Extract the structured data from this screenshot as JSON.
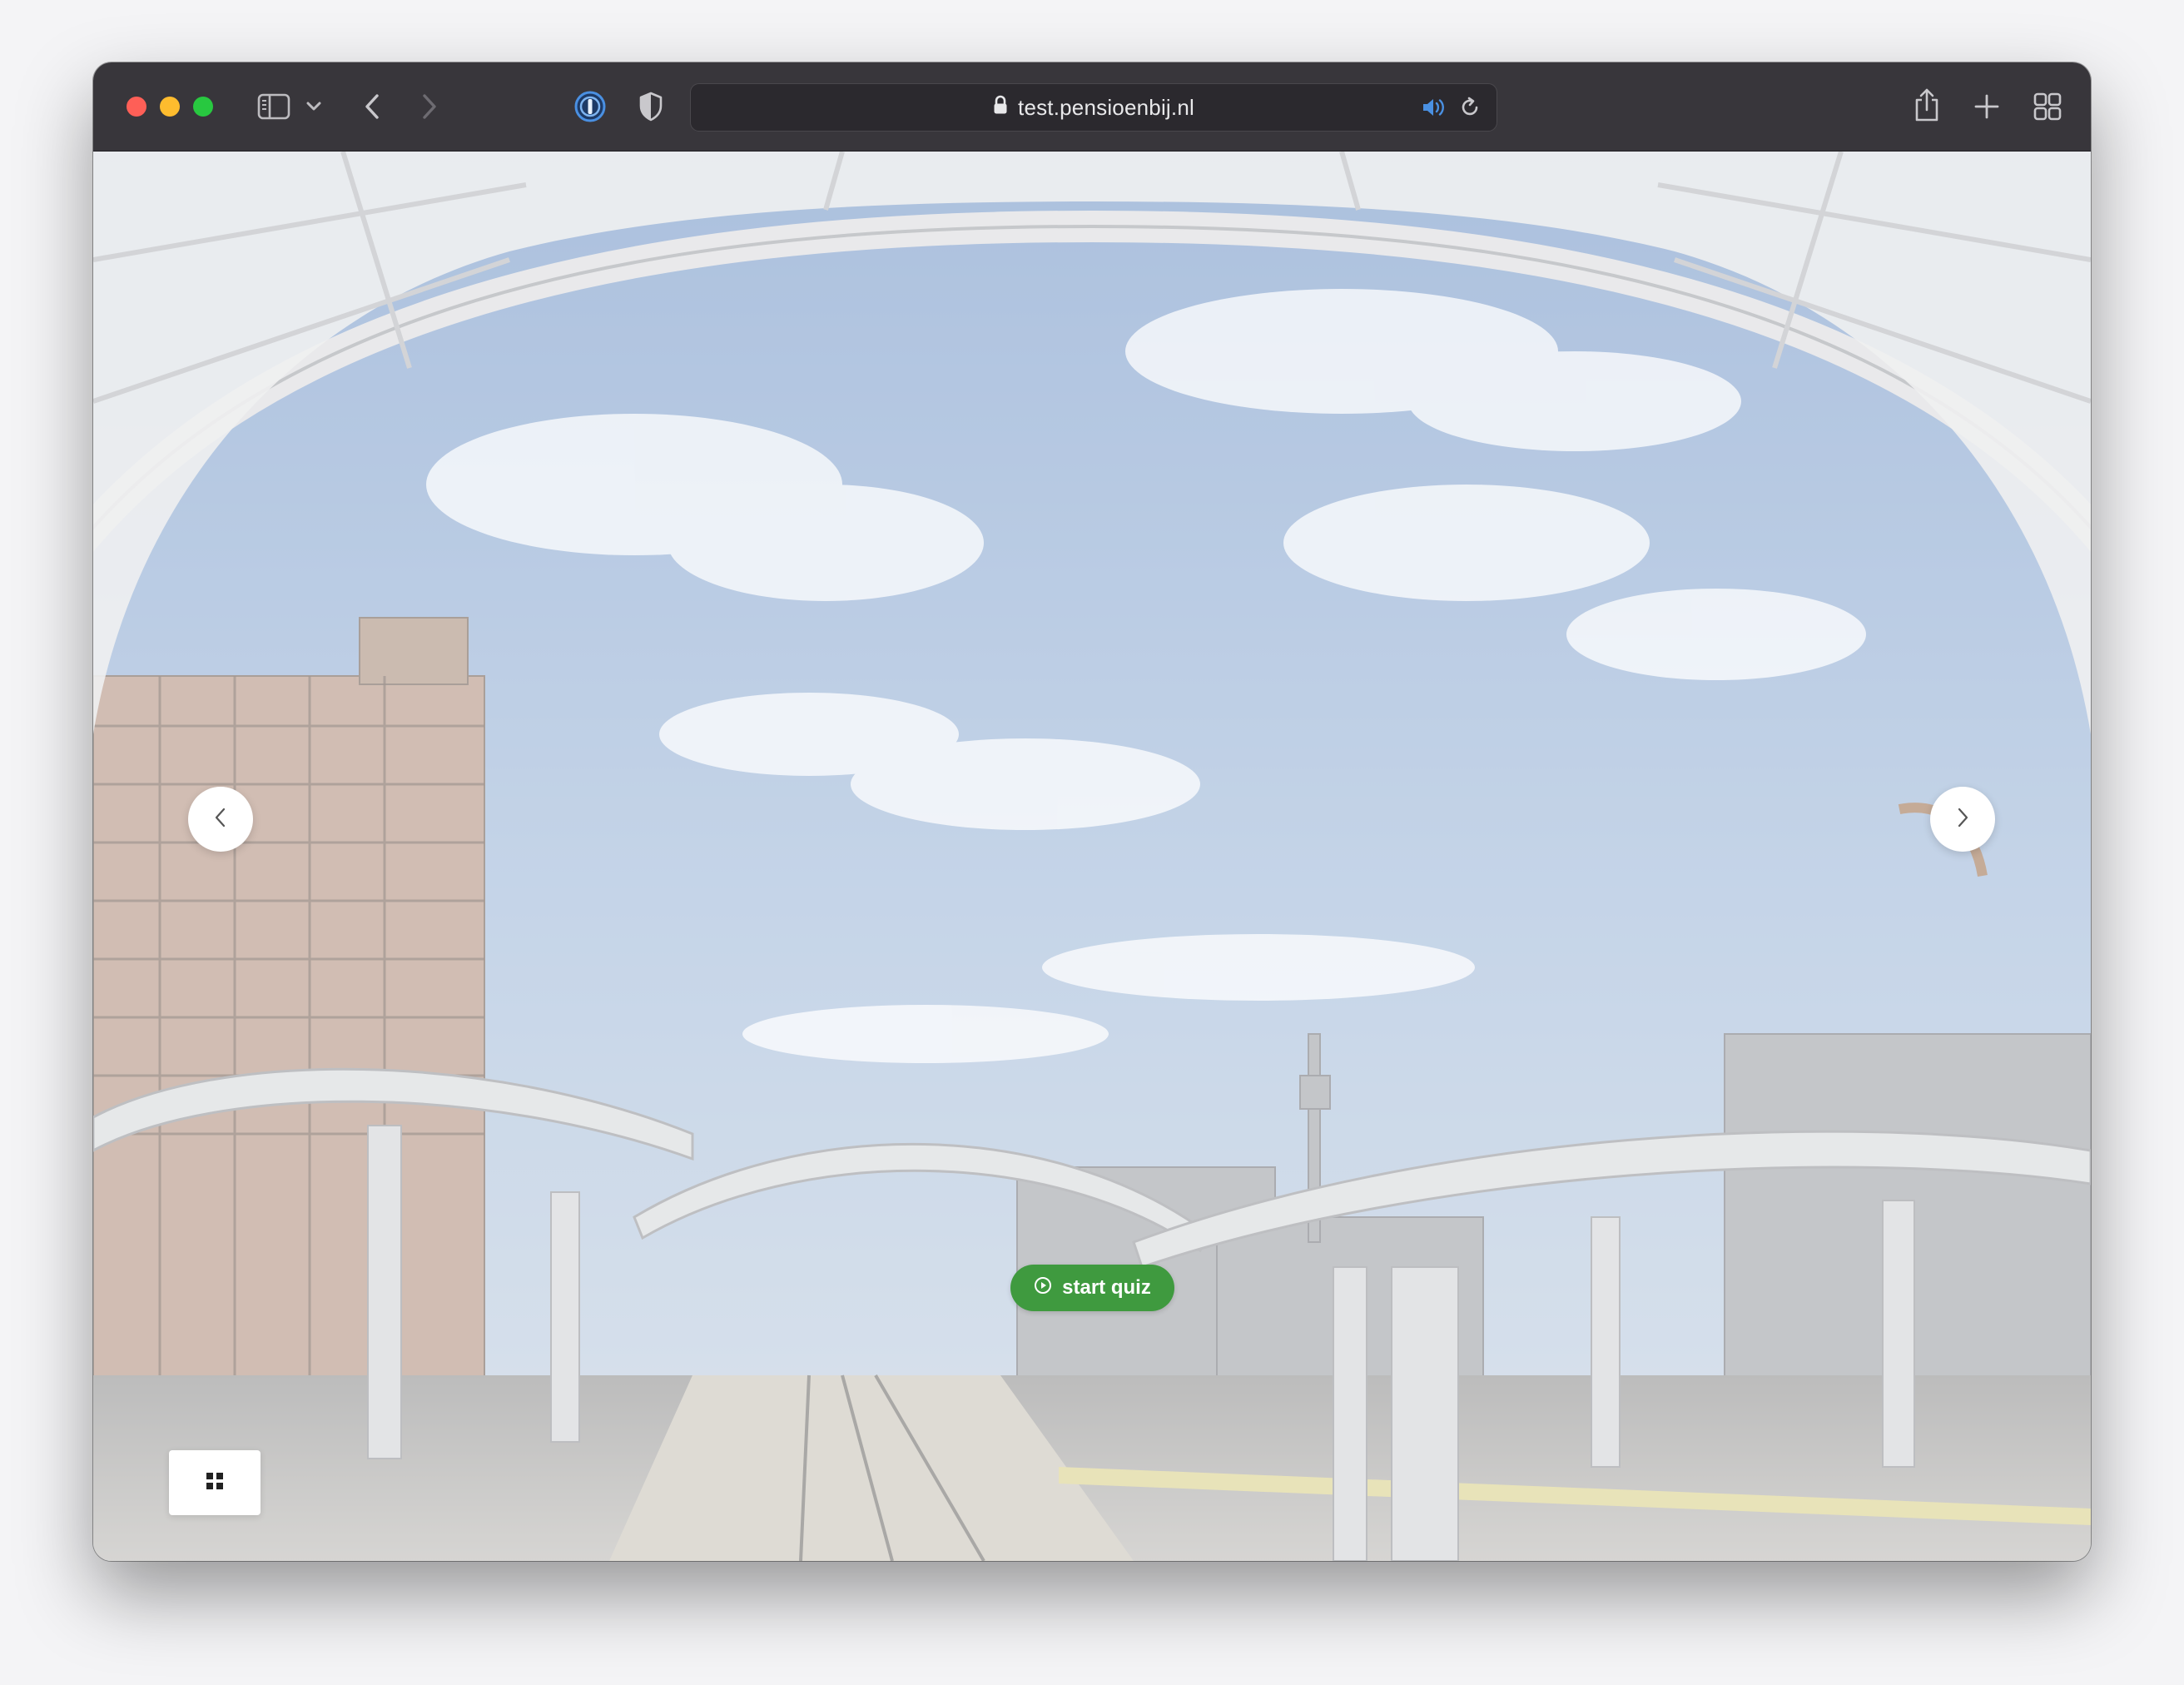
{
  "browser": {
    "url": "test.pensioenbij.nl"
  },
  "toolbar_icons": {
    "close": "close-window-button",
    "minimize": "minimize-window-button",
    "zoom": "zoom-window-button",
    "sidebar": "sidebar-toggle-icon",
    "chevron": "chevron-down-icon",
    "back": "back-arrow-icon",
    "forward": "forward-arrow-icon",
    "password_manager": "1password-extension-icon",
    "shield": "privacy-shield-icon",
    "lock": "lock-icon",
    "audio": "speaker-audio-icon",
    "reload": "reload-icon",
    "share": "share-icon",
    "new_tab": "plus-new-tab-icon",
    "tab_overview": "tab-overview-grid-icon"
  },
  "colors": {
    "traffic_red": "#fe5f57",
    "traffic_yellow": "#febc2e",
    "traffic_green": "#28c840",
    "button_green": "#3f9a3f",
    "extension_blue": "#4a90e2"
  },
  "page": {
    "start_button_label": "start quiz",
    "start_button_icon": "play-circle-icon",
    "prev_icon": "chevron-left-icon",
    "next_icon": "chevron-right-icon",
    "menu_icon": "grid-four-squares-icon"
  }
}
